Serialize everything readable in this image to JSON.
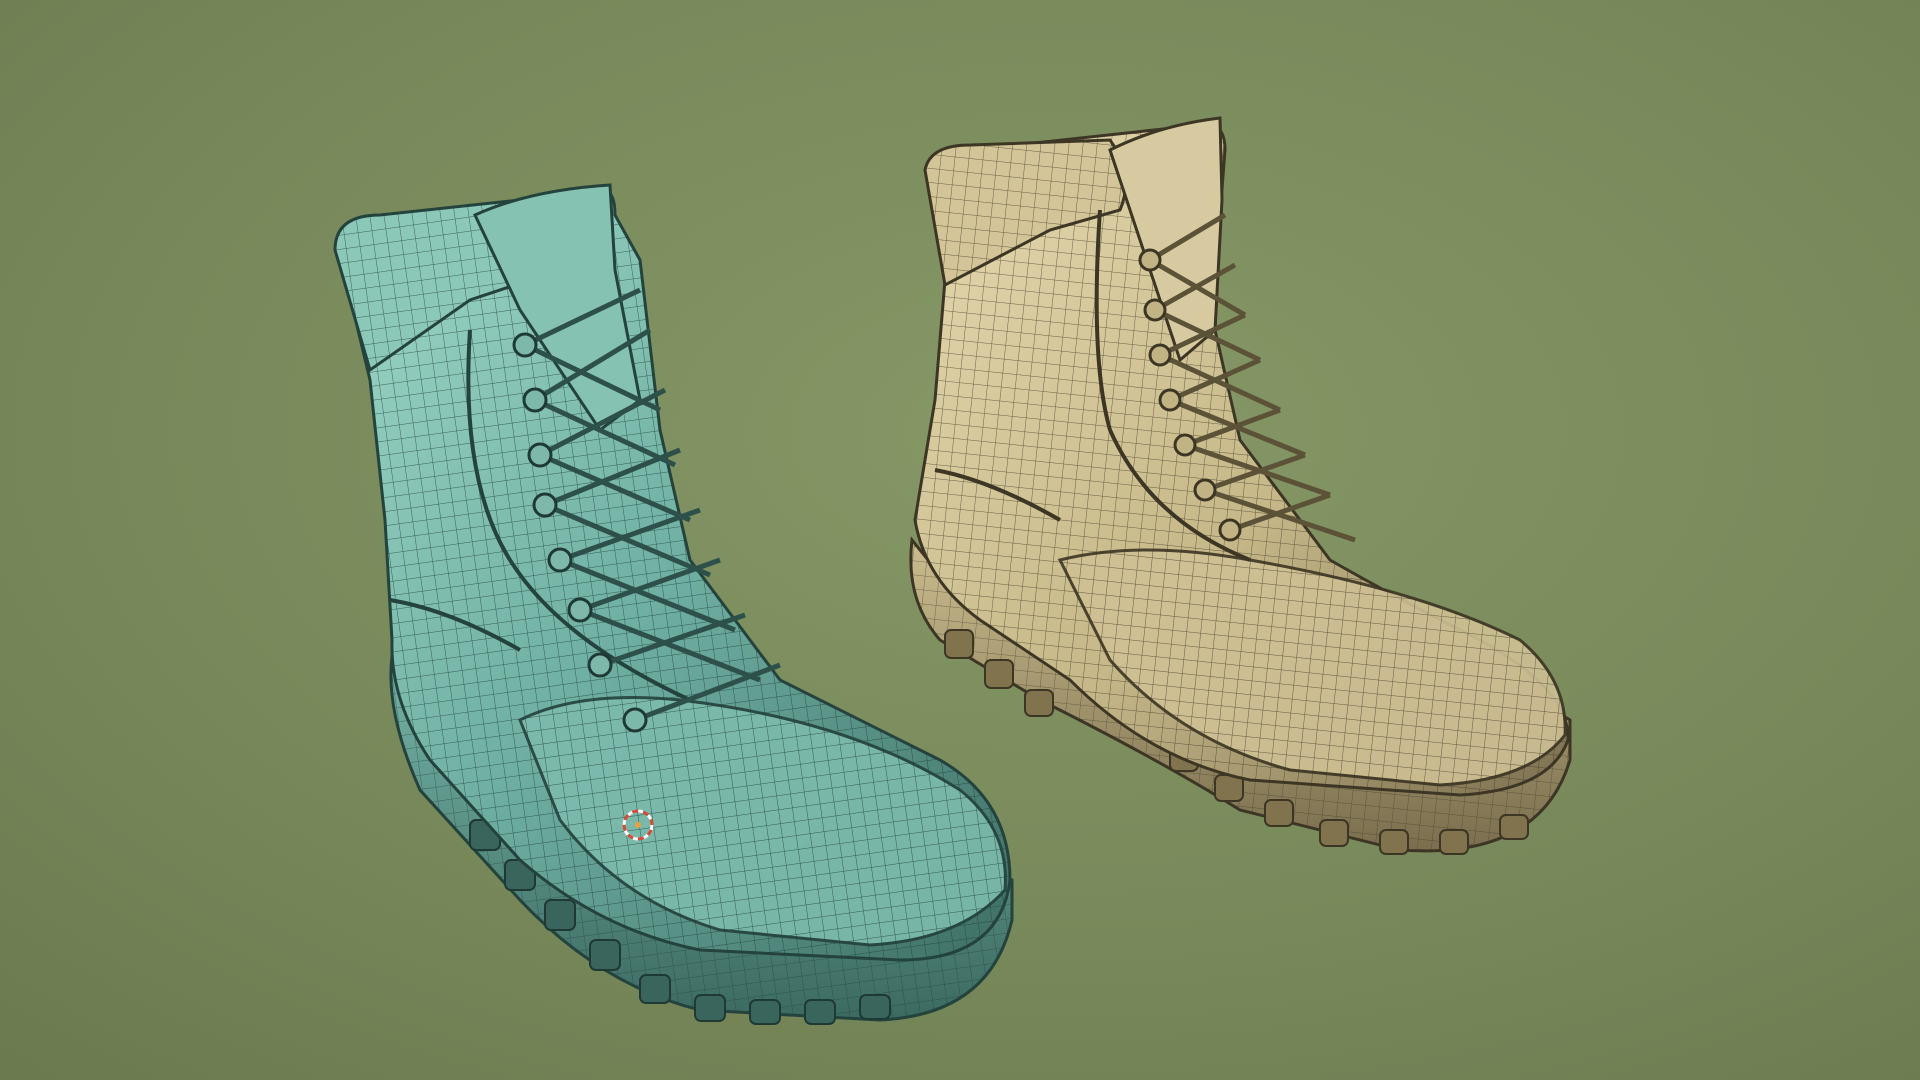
{
  "viewport": {
    "background_colors": [
      "#7b8c5e",
      "#6f8052",
      "#8fa06f"
    ]
  },
  "objects": [
    {
      "name": "boot-model-teal",
      "material_color": "#6fb0a2",
      "highlight_color": "#9fd8c8",
      "shadow_color": "#3e6f65"
    },
    {
      "name": "boot-model-tan",
      "material_color": "#c6b888",
      "highlight_color": "#e6dab0",
      "shadow_color": "#7c7050"
    }
  ],
  "cursor": {
    "name": "3d-cursor",
    "colors": [
      "#d84a3a",
      "#ffffff"
    ]
  }
}
